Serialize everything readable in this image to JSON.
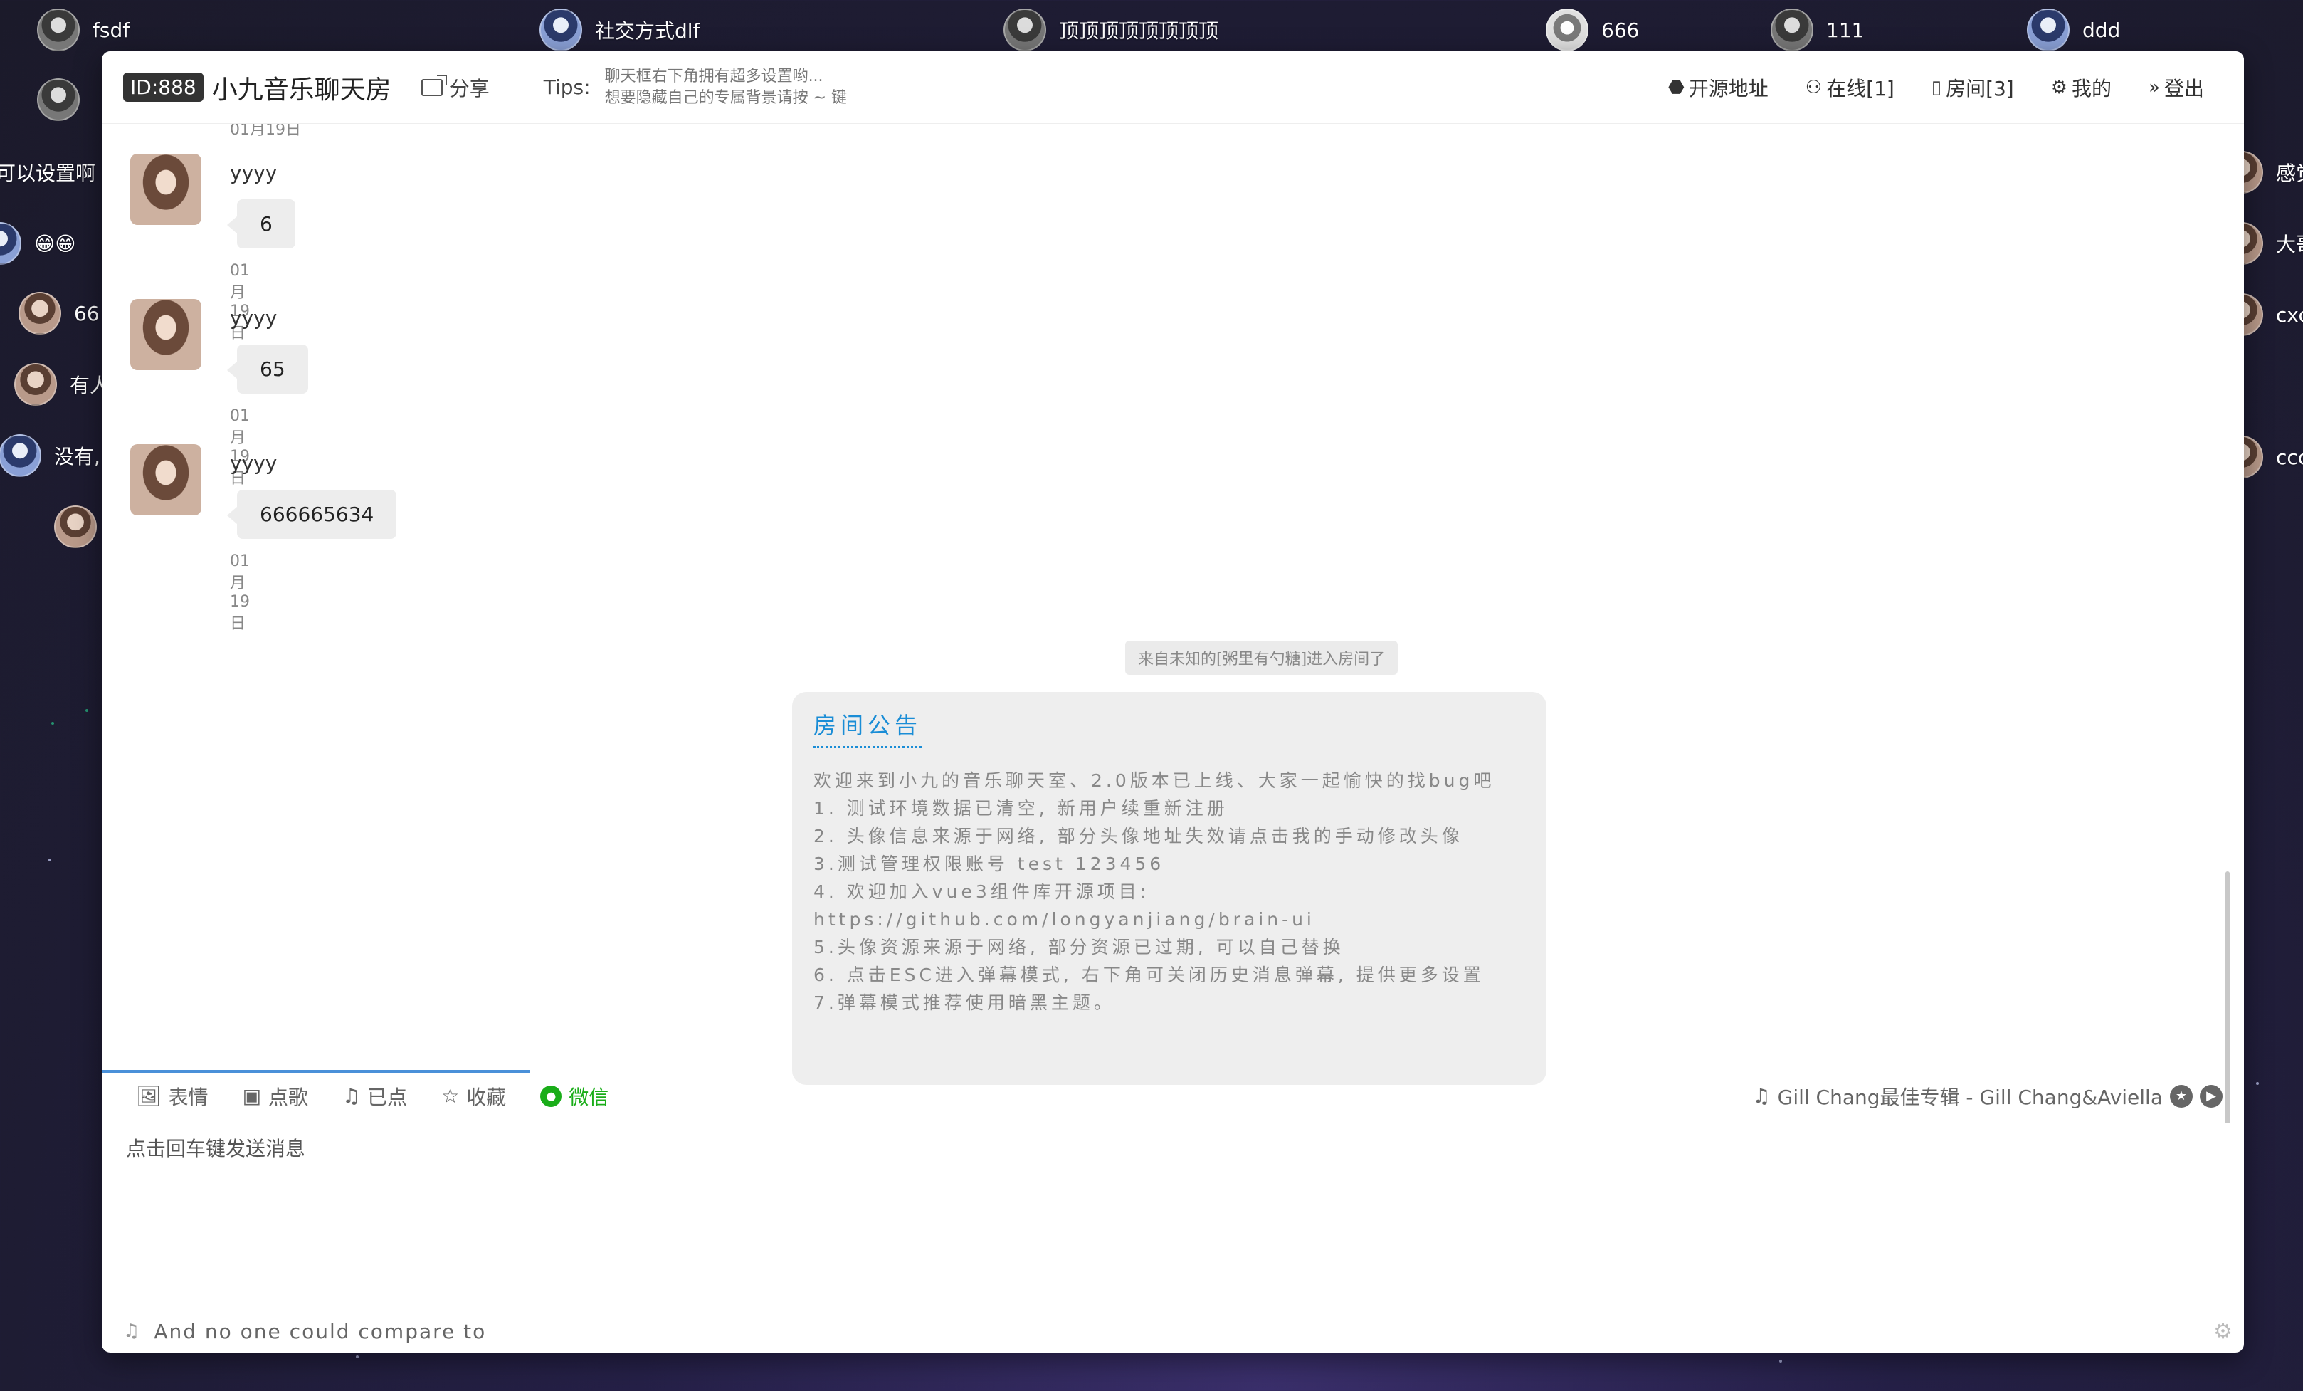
{
  "danmaku_top": [
    {
      "name": "fsdf",
      "avatar": "dark"
    },
    {
      "name": "社交方式dlf",
      "avatar": "blue"
    },
    {
      "name": "顶顶顶顶顶顶顶顶",
      "avatar": "dark"
    },
    {
      "name": "666",
      "avatar": "dog"
    },
    {
      "name": "111",
      "avatar": "dark"
    },
    {
      "name": "ddd",
      "avatar": "blue"
    }
  ],
  "danmaku_left": [
    {
      "text": "可以设置啊 我",
      "avatar": ""
    },
    {
      "text": "😁😁",
      "avatar": "blue"
    },
    {
      "text": "66",
      "avatar": "girl"
    },
    {
      "text": "有人",
      "avatar": "girl"
    },
    {
      "text": "没有,",
      "avatar": "blue"
    }
  ],
  "danmaku_right": [
    {
      "text": "感觉"
    },
    {
      "text": "大哥"
    },
    {
      "text": "cxc"
    },
    {
      "text": "ccc"
    }
  ],
  "header": {
    "room_id": "ID:888",
    "room_title": "小九音乐聊天房",
    "share_label": "分享",
    "tips_label": "Tips:",
    "tips_lines": [
      "聊天框右下角拥有超多设置哟...",
      "想要隐藏自己的专属背景请按 ~ 键"
    ],
    "nav": {
      "source": "开源地址",
      "online": "在线[1]",
      "rooms": "房间[3]",
      "mine": "我的",
      "logout": "登出"
    },
    "icons": {
      "source": "github-icon",
      "online": "users-icon",
      "rooms": "book-icon",
      "mine": "gear-icon",
      "logout": "double-chevron-right-icon"
    }
  },
  "chat": {
    "cut_date": "01月19日",
    "messages": [
      {
        "user": "yyyy",
        "text": "6",
        "time": "01月19日"
      },
      {
        "user": "yyyy",
        "text": "65",
        "time": "01月19日"
      },
      {
        "user": "yyyy",
        "text": "666665634",
        "time": "01月19日"
      }
    ],
    "system_note": "来自未知的[粥里有勺糖]进入房间了",
    "notice": {
      "title": "房间公告",
      "lines": [
        "欢迎来到小九的音乐聊天室、2.0版本已上线、大家一起愉快的找bug吧",
        "1. 测试环境数据已清空, 新用户续重新注册",
        "2. 头像信息来源于网络, 部分头像地址失效请点击我的手动修改头像",
        "3.测试管理权限账号 test 123456",
        "4. 欢迎加入vue3组件库开源项目: https://github.com/longyanjiang/brain-ui",
        "5.头像资源来源于网络, 部分资源已过期, 可以自己替换",
        "6. 点击ESC进入弹幕模式, 右下角可关闭历史消息弹幕, 提供更多设置",
        "7.弹幕模式推荐使用暗黑主题。"
      ]
    }
  },
  "toolbar": {
    "emoji": "表情",
    "order_song": "点歌",
    "ordered": "已点",
    "favorite": "收藏",
    "wechat": "微信",
    "now_playing": "Gill Chang最佳专辑 - Gill Chang&Aviella",
    "progress": 0.2
  },
  "input": {
    "placeholder": "点击回车键发送消息"
  },
  "lyric": {
    "text": "And no one could compare to"
  },
  "colors": {
    "accent": "#1a8dd6",
    "wechat": "#1aad19",
    "progress": "#4a90d9"
  }
}
